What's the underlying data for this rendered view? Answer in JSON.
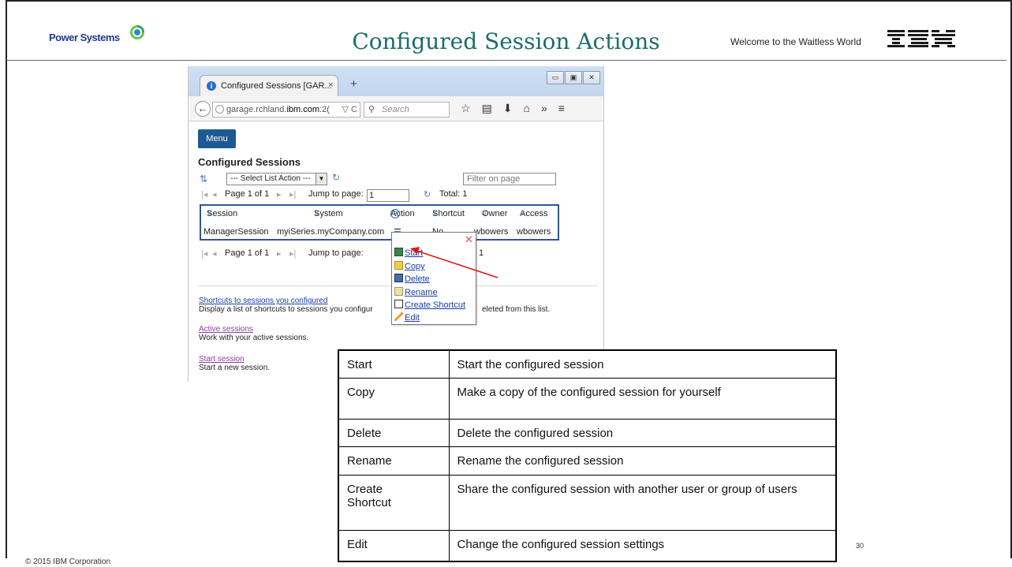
{
  "slide": {
    "title": "Configured Session Actions",
    "brand": "Power Systems",
    "tagline": "Welcome to the Waitless World",
    "ibm_logo_text": "IBM",
    "copyright": "© 2015 IBM Corporation",
    "page_number": "30"
  },
  "browser": {
    "tab_title": "Configured Sessions [GAR...",
    "tab_close": "×",
    "new_tab": "+",
    "window_buttons": [
      "▭",
      "▣",
      "✕"
    ],
    "url_prefix": "garage.rchland.",
    "url_domain": "ibm.com",
    "url_suffix": ":2(",
    "url_controls": "▽ C",
    "search_placeholder": "Search"
  },
  "page": {
    "menu_button": "Menu",
    "section_title": "Configured Sessions",
    "list_action_select": "--- Select List Action ---",
    "filter_placeholder": "Filter on page",
    "pager_top": {
      "page_label": "Page 1 of 1",
      "jump_label": "Jump to page:",
      "jump_value": "1",
      "total": "Total: 1"
    },
    "pager_bottom": {
      "page_label": "Page 1 of 1",
      "jump_label": "Jump to page:",
      "total_fragment": "1"
    },
    "table": {
      "columns": [
        "Session",
        "System",
        "Action",
        "Shortcut",
        "Owner",
        "Access"
      ],
      "rows": [
        {
          "session": "ManagerSession",
          "system": "myiSeries.myCompany.com",
          "action": "",
          "shortcut": "No",
          "owner": "wbowers",
          "access": "wbowers"
        }
      ]
    },
    "context_menu": [
      "Start",
      "Copy",
      "Delete",
      "Rename",
      "Create Shortcut",
      "Edit"
    ],
    "links": [
      {
        "label": "Shortcuts to sessions you configured",
        "description": "Display a list of shortcuts to sessions you configur",
        "description_tail": "eleted from this list."
      },
      {
        "label": "Active sessions",
        "description": "Work with your active sessions."
      },
      {
        "label": "Start session",
        "description": "Start a new session."
      }
    ]
  },
  "actions_table": [
    {
      "action": "Start",
      "description": "Start the configured session"
    },
    {
      "action": "Copy",
      "description": "Make a copy of the configured session for yourself"
    },
    {
      "action": "Delete",
      "description": "Delete the configured session"
    },
    {
      "action": "Rename",
      "description": "Rename the configured session"
    },
    {
      "action": "Create Shortcut",
      "description": "Share the configured session with another user or group of users"
    },
    {
      "action": "Edit",
      "description": "Change the configured session settings"
    }
  ],
  "colors": {
    "title_teal": "#1b6e6e",
    "menu_blue": "#1d5a93",
    "link_blue": "#1a3fa3",
    "visited_link": "#8a3e9e",
    "arrow_red": "#e0161b",
    "table_border_blue": "#2f5597"
  }
}
